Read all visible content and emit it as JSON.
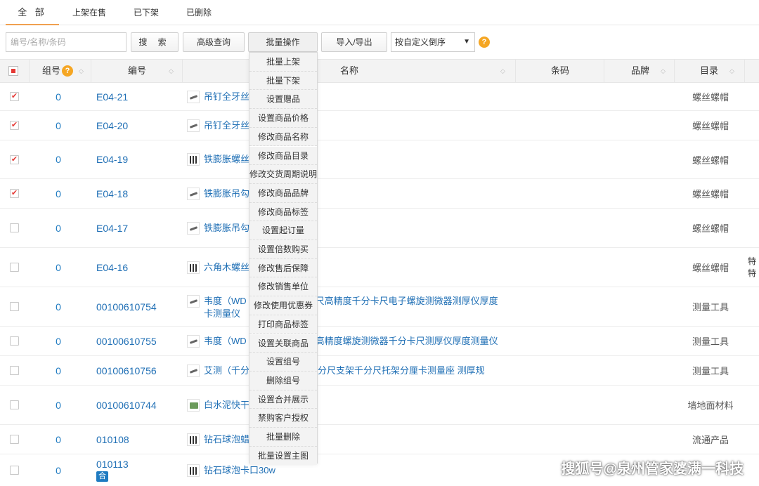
{
  "tabs": [
    "全 部",
    "上架在售",
    "已下架",
    "已删除"
  ],
  "toolbar": {
    "search_placeholder": "编号/名称/条码",
    "search_label": "搜 索",
    "advanced_label": "高级查询",
    "batch_label": "批量操作",
    "import_export_label": "导入/导出",
    "sort_value": "按自定义倒序"
  },
  "header": {
    "group": "组号",
    "code": "编号",
    "name": "名称",
    "barcode": "条码",
    "brand": "品牌",
    "category": "目录"
  },
  "batch_menu": [
    "批量上架",
    "批量下架",
    "设置赠品",
    "设置商品价格",
    "修改商品名称",
    "修改商品目录",
    "修改交货周期说明",
    "修改商品品牌",
    "修改商品标签",
    "设置起订量",
    "设置倍数购买",
    "修改售后保障",
    "修改销售单位",
    "修改使用优惠券",
    "打印商品标签",
    "设置关联商品",
    "设置组号",
    "删除组号",
    "设置合并展示",
    "禁购客户授权",
    "批量删除",
    "批量设置主图"
  ],
  "rows": [
    {
      "checked": "✔",
      "group": "0",
      "code": "E04-21",
      "name": "吊钉全牙丝",
      "name2": "",
      "category": "螺丝螺帽",
      "badge": ""
    },
    {
      "checked": "✔",
      "group": "0",
      "code": "E04-20",
      "name": "吊钉全牙丝",
      "name2": "",
      "category": "螺丝螺帽",
      "badge": ""
    },
    {
      "checked": "✔",
      "group": "0",
      "code": "E04-19",
      "name": "铁膨胀螺丝",
      "name2": "",
      "category": "螺丝螺帽",
      "badge": ""
    },
    {
      "checked": "✔",
      "group": "0",
      "code": "E04-18",
      "name": "铁膨胀吊勾",
      "name2": "",
      "category": "螺丝螺帽",
      "badge": ""
    },
    {
      "checked": "",
      "group": "0",
      "code": "E04-17",
      "name": "铁膨胀吊勾",
      "name2": "",
      "category": "螺丝螺帽",
      "badge": ""
    },
    {
      "checked": "",
      "group": "0",
      "code": "E04-16",
      "name": "六角木螺丝",
      "name2": "",
      "category": "螺丝螺帽",
      "badge": "",
      "tail1": "特",
      "tail2": "特"
    },
    {
      "checked": "",
      "group": "0",
      "code": "00100610754",
      "name": "韦度（WD",
      "name_cont": "尺高精度千分卡尺电子螺旋测微器测厚仪厚度",
      "name2": "卡测量仪",
      "category": "测量工具",
      "badge": ""
    },
    {
      "checked": "",
      "group": "0",
      "code": "00100610755",
      "name": "韦度（WD",
      "name_cont": "高精度螺旋测微器千分卡尺测厚仪厚度测量仪",
      "name2": "",
      "category": "测量工具",
      "badge": ""
    },
    {
      "checked": "",
      "group": "0",
      "code": "00100610756",
      "name": "艾测（千分",
      "name_cont": "千分尺支架千分尺托架分厘卡测量座 测厚规",
      "name2": "",
      "category": "测量工具",
      "badge": ""
    },
    {
      "checked": "",
      "group": "0",
      "code": "00100610744",
      "name": "白水泥快干",
      "name2": "",
      "category": "墙地面材料",
      "badge": ""
    },
    {
      "checked": "",
      "group": "0",
      "code": "010108",
      "name": "钻石球泡蜡",
      "name2": "",
      "category": "流通产品",
      "badge": ""
    },
    {
      "checked": "",
      "group": "0",
      "code": "010113",
      "name": "钻石球泡卡口30w",
      "name2": "",
      "category": "",
      "badge": "合"
    }
  ],
  "watermark": "搜狐号@泉州管家婆满一科技",
  "colors": {
    "accent_tab": "#f0a050",
    "link": "#1f6fb5",
    "help": "#f5a623",
    "check": "#e53935"
  }
}
